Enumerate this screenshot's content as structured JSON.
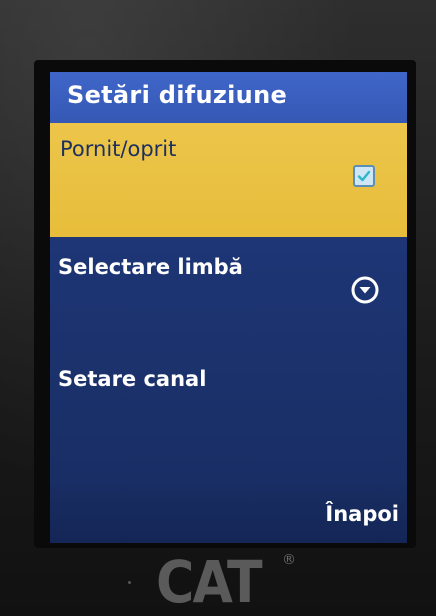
{
  "screen": {
    "title": "Setări difuziune",
    "items": [
      {
        "label": "Pornit/oprit",
        "control": "checkbox",
        "checked": true,
        "selected": true
      },
      {
        "label": "Selectare limbă",
        "control": "dropdown"
      },
      {
        "label": "Setare canal",
        "control": "none"
      }
    ],
    "softkey_right": "Înapoi"
  },
  "device": {
    "brand": "CAT",
    "brand_mark": "®"
  },
  "colors": {
    "title_bar": "#3f66c9",
    "screen_bg": "#1d3574",
    "selected_row": "#ecc54a",
    "selected_text": "#1d2f5f",
    "text": "#ffffff"
  },
  "icons": {
    "checkbox": "check-icon",
    "dropdown": "chevron-down-circle-icon"
  }
}
